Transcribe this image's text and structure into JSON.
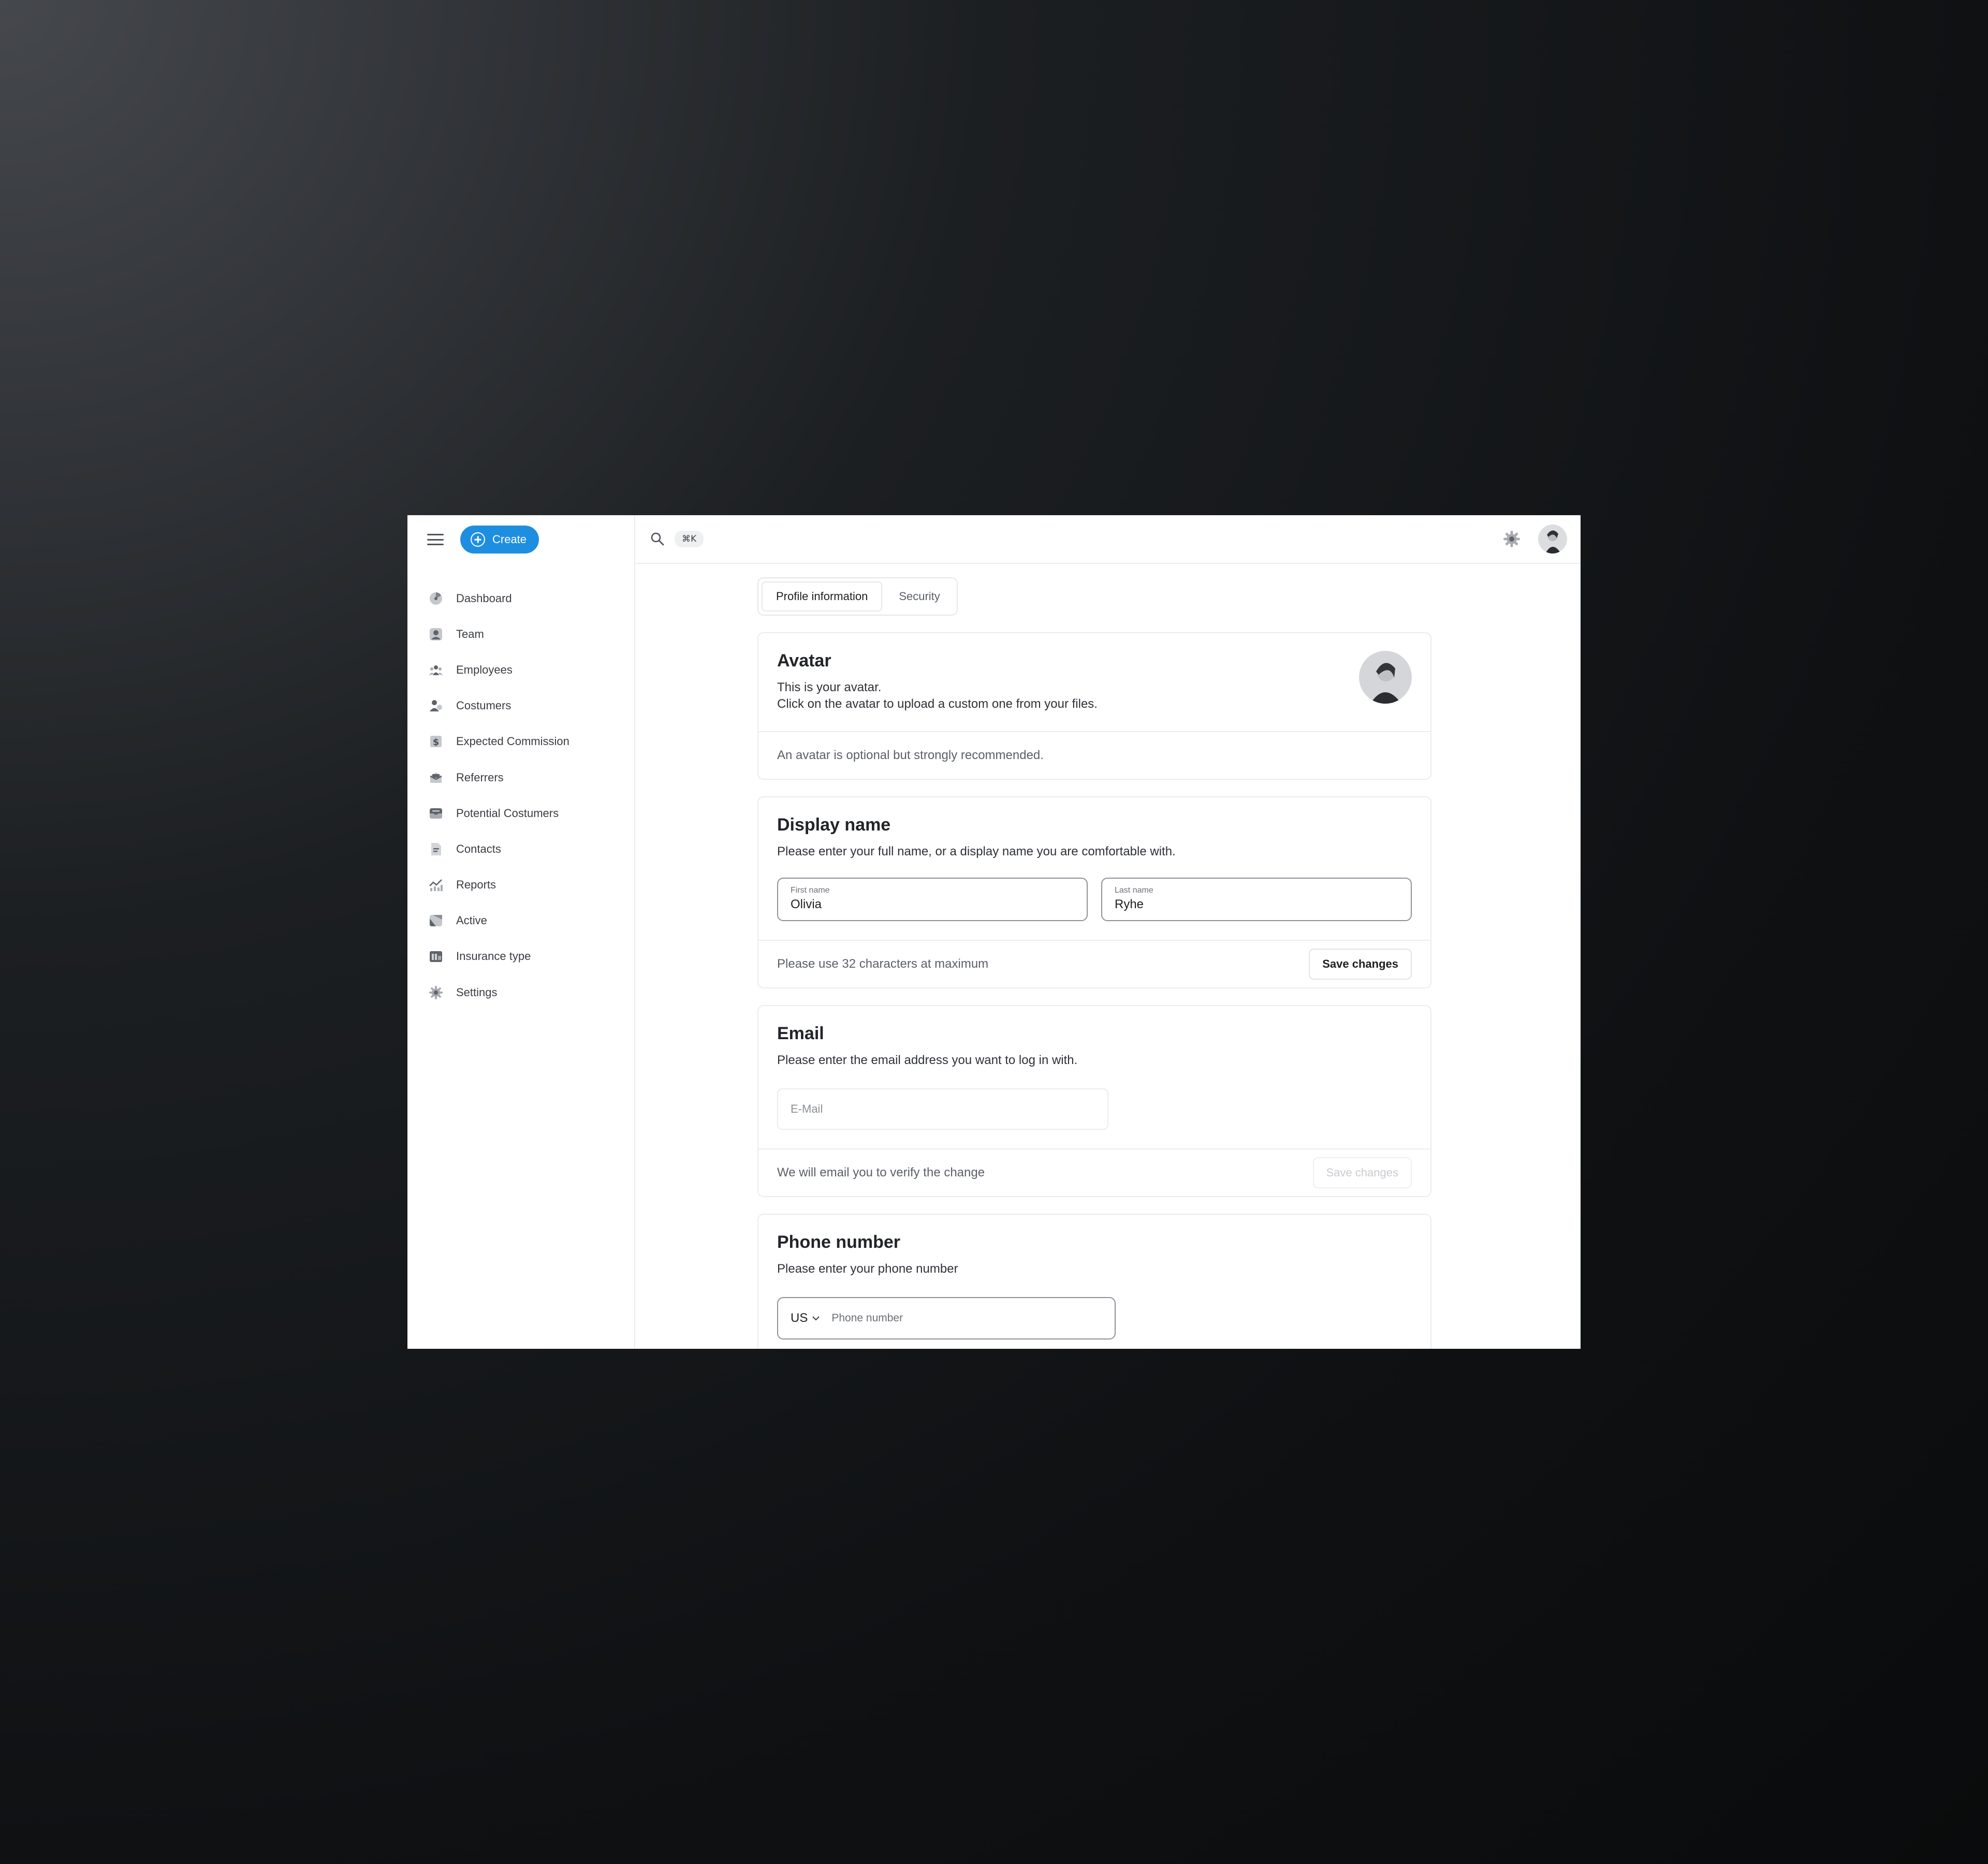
{
  "sidebar": {
    "create_label": "Create",
    "items": [
      {
        "label": "Dashboard",
        "icon": "dashboard-icon"
      },
      {
        "label": "Team",
        "icon": "team-icon"
      },
      {
        "label": "Employees",
        "icon": "employees-icon"
      },
      {
        "label": "Costumers",
        "icon": "customers-icon"
      },
      {
        "label": "Expected Commission",
        "icon": "dollar-icon"
      },
      {
        "label": "Referrers",
        "icon": "referrers-icon"
      },
      {
        "label": "Potential Costumers",
        "icon": "inbox-icon"
      },
      {
        "label": "Contacts",
        "icon": "contacts-icon"
      },
      {
        "label": "Reports",
        "icon": "chart-icon"
      },
      {
        "label": "Active",
        "icon": "pie-icon"
      },
      {
        "label": "Insurance type",
        "icon": "insurance-icon"
      },
      {
        "label": "Settings",
        "icon": "gear-icon"
      }
    ]
  },
  "topbar": {
    "shortcut": "⌘K"
  },
  "tabs": [
    {
      "label": "Profile information",
      "active": true
    },
    {
      "label": "Security",
      "active": false
    }
  ],
  "avatar_card": {
    "title": "Avatar",
    "desc_line1": "This is your avatar.",
    "desc_line2": "Click on the avatar to upload a custom one from your files.",
    "footer": "An avatar is optional but strongly recommended."
  },
  "display_name_card": {
    "title": "Display name",
    "desc": "Please enter your full name, or a display name you are comfortable with.",
    "first_name_label": "First name",
    "first_name_value": "Olivia",
    "last_name_label": "Last name",
    "last_name_value": "Ryhe",
    "footer": "Please use 32 characters at maximum",
    "save_label": "Save changes"
  },
  "email_card": {
    "title": "Email",
    "desc": "Please enter the email address you want to log in with.",
    "placeholder": "E-Mail",
    "footer": "We will email you to verify the change",
    "save_label": "Save changes"
  },
  "phone_card": {
    "title": "Phone number",
    "desc": "Please enter your phone number",
    "country": "US",
    "placeholder": "Phone number"
  },
  "colors": {
    "accent": "#1e8ee0",
    "icon_gray": "#8a8e95"
  }
}
